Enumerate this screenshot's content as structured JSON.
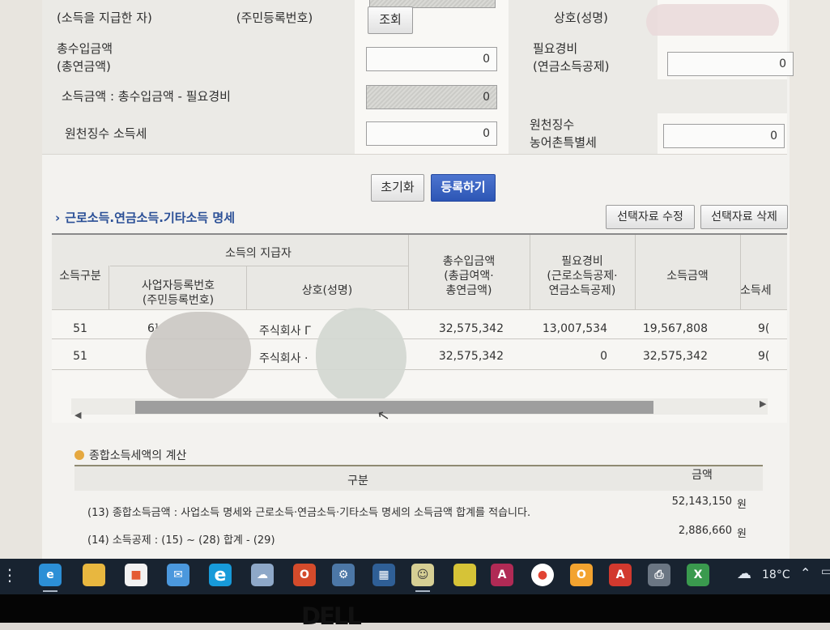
{
  "form": {
    "payer_label": "(소득을 지급한 자)",
    "id_label": "(주민등록번호)",
    "lookup_button": "조회",
    "name_label": "상호(성명)",
    "total_income_label_1": "총수입금액",
    "total_income_label_2": "(총연금액)",
    "total_income_value": "0",
    "expense_label_1": "필요경비",
    "expense_label_2": "(연금소득공제)",
    "expense_value": "0",
    "income_formula_label": "소득금액 : 총수입금액 - 필요경비",
    "income_value": "0",
    "withholding_tax_label": "원천징수 소득세",
    "withholding_tax_value": "0",
    "rural_tax_label_1": "원천징수",
    "rural_tax_label_2": "농어촌특별세",
    "rural_tax_value": "0"
  },
  "actions": {
    "reset": "초기화",
    "register": "등록하기"
  },
  "details": {
    "title": "근로소득.연금소득.기타소득 명세",
    "edit_selected": "선택자료 수정",
    "delete_selected": "선택자료 삭제",
    "columns": {
      "income_type": "소득구분",
      "payer": "소득의 지급자",
      "business_no": "사업자등록번호",
      "business_no_sub": "(주민등록번호)",
      "company": "상호(성명)",
      "total_income": "총수입금액",
      "total_income_sub1": "(총급여액·",
      "total_income_sub2": "총연금액)",
      "expense": "필요경비",
      "expense_sub1": "(근로소득공제·",
      "expense_sub2": "연금소득공제)",
      "income": "소득금액",
      "tax_partial": "소득세"
    },
    "rows": [
      {
        "type": "51",
        "biz_no": "6¹",
        "company": "주식회사 Γ",
        "total": "32,575,342",
        "expense": "13,007,534",
        "income": "19,567,808",
        "tax": "9("
      },
      {
        "type": "51",
        "biz_no": "",
        "company": "주식회사 ·",
        "total": "32,575,342",
        "expense": "0",
        "income": "32,575,342",
        "tax": "9("
      }
    ]
  },
  "summary": {
    "title": "종합소득세액의 계산",
    "header_item": "구분",
    "header_amount": "금액",
    "rows": [
      {
        "label": "(13) 종합소득금액 : 사업소득 명세와 근로소득·연금소득·기타소득 명세의 소득금액 합계를 적습니다.",
        "amount": "52,143,150",
        "unit": "원"
      },
      {
        "label": "(14) 소득공제 : (15) ~ (28) 합계 - (29)",
        "amount": "2,886,660",
        "unit": "원"
      }
    ]
  },
  "taskbar": {
    "weather_temp": "18°C"
  },
  "colors": {
    "primary_button": "#2d56b5",
    "section_title": "#2a4f96",
    "taskbar": "#182330"
  },
  "icons": [
    "edge-icon",
    "file-explorer-icon",
    "store-icon",
    "mail-icon",
    "internet-explorer-icon",
    "cloud-icon",
    "office-icon",
    "app-icon",
    "calculator-icon",
    "user-icon",
    "sticky-notes-icon",
    "access-icon",
    "chrome-icon",
    "outlook-icon",
    "acrobat-icon",
    "printer-icon",
    "excel-icon"
  ]
}
